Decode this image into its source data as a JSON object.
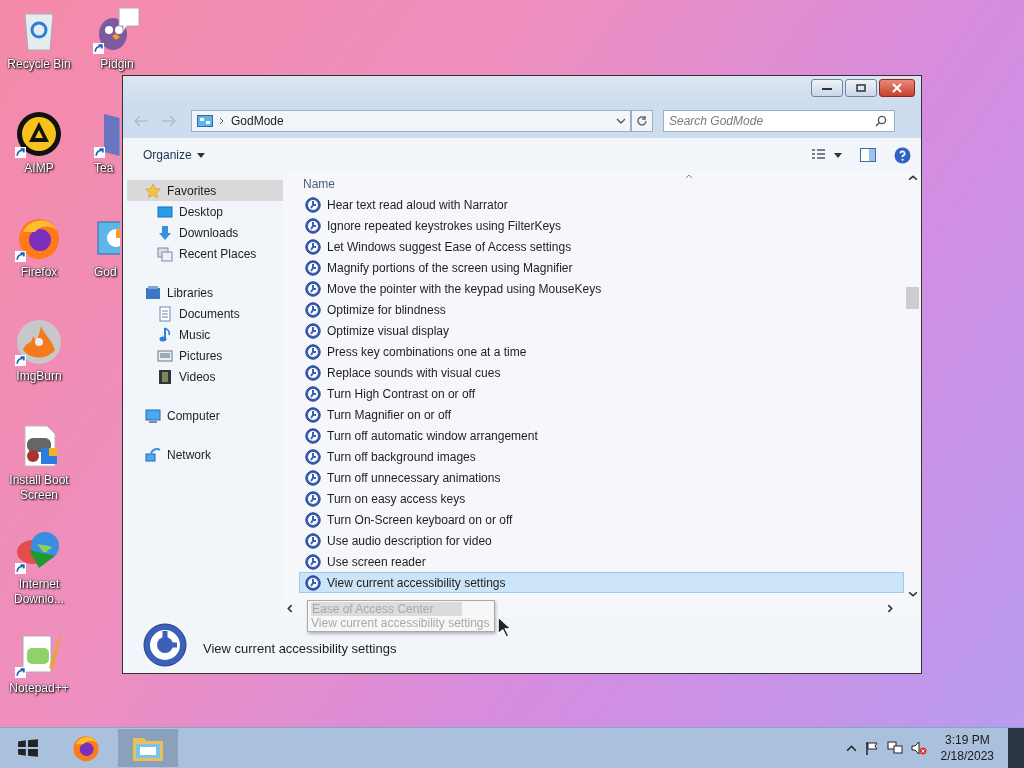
{
  "desktop_icons": [
    {
      "kind": "recycle",
      "label": "Recycle Bin",
      "shortcut": false
    },
    {
      "kind": "aimp",
      "label": "AIMP",
      "shortcut": true
    },
    {
      "kind": "firefox",
      "label": "Firefox",
      "shortcut": true
    },
    {
      "kind": "disc",
      "label": "ImgBurn",
      "shortcut": true
    },
    {
      "kind": "installer",
      "label": "Install Boot Screen",
      "shortcut": false
    },
    {
      "kind": "globe",
      "label": "Internet Downlo...",
      "shortcut": true
    },
    {
      "kind": "notepad",
      "label": "Notepad++",
      "shortcut": true
    },
    {
      "kind": "bird",
      "label": "Pidgin",
      "shortcut": true
    },
    {
      "kind": "book",
      "label": "Tea",
      "shortcut": true
    },
    {
      "kind": "panel",
      "label": "God",
      "shortcut": false
    }
  ],
  "window": {
    "address": {
      "path": "GodMode"
    },
    "search": {
      "placeholder": "Search GodMode"
    },
    "toolbar": {
      "organize": "Organize"
    },
    "nav": [
      {
        "kind": "star",
        "label": "Favorites",
        "selected": true,
        "children": [
          {
            "kind": "desktop",
            "label": "Desktop",
            "selected": false
          },
          {
            "kind": "download",
            "label": "Downloads",
            "selected": false
          },
          {
            "kind": "recent",
            "label": "Recent Places",
            "selected": false
          }
        ]
      },
      {
        "kind": "library",
        "label": "Libraries",
        "selected": false,
        "children": [
          {
            "kind": "document",
            "label": "Documents",
            "selected": false
          },
          {
            "kind": "music",
            "label": "Music",
            "selected": false
          },
          {
            "kind": "picture",
            "label": "Pictures",
            "selected": false
          },
          {
            "kind": "video",
            "label": "Videos",
            "selected": false
          }
        ]
      },
      {
        "kind": "computer",
        "label": "Computer",
        "selected": false
      },
      {
        "kind": "network",
        "label": "Network",
        "selected": false
      }
    ],
    "list": {
      "column": "Name",
      "items": [
        {
          "label": "Hear text read aloud with Narrator",
          "selected": false
        },
        {
          "label": "Ignore repeated keystrokes using FilterKeys",
          "selected": false
        },
        {
          "label": "Let Windows suggest Ease of Access settings",
          "selected": false
        },
        {
          "label": "Magnify portions of the screen using Magnifier",
          "selected": false
        },
        {
          "label": "Move the pointer with the keypad using MouseKeys",
          "selected": false
        },
        {
          "label": "Optimize for blindness",
          "selected": false
        },
        {
          "label": "Optimize visual display",
          "selected": false
        },
        {
          "label": "Press key combinations one at a time",
          "selected": false
        },
        {
          "label": "Replace sounds with visual cues",
          "selected": false
        },
        {
          "label": "Turn High Contrast on or off",
          "selected": false
        },
        {
          "label": "Turn Magnifier on or off",
          "selected": false
        },
        {
          "label": "Turn off automatic window arrangement",
          "selected": false
        },
        {
          "label": "Turn off background images",
          "selected": false
        },
        {
          "label": "Turn off unnecessary animations",
          "selected": false
        },
        {
          "label": "Turn on easy access keys",
          "selected": false
        },
        {
          "label": "Turn On-Screen keyboard on or off",
          "selected": false
        },
        {
          "label": "Use audio description for video",
          "selected": false
        },
        {
          "label": "Use screen reader",
          "selected": false
        },
        {
          "label": "View current accessibility settings",
          "selected": true
        }
      ]
    },
    "tooltip": {
      "title": "Ease of Access Center",
      "text": "View current accessibility settings"
    },
    "details": {
      "text": "View current accessibility settings"
    }
  },
  "taskbar": {
    "apps": [
      {
        "kind": "firefox",
        "selected": false
      },
      {
        "kind": "explorer",
        "selected": true
      }
    ],
    "time": "3:19 PM",
    "date": "2/18/2023"
  }
}
